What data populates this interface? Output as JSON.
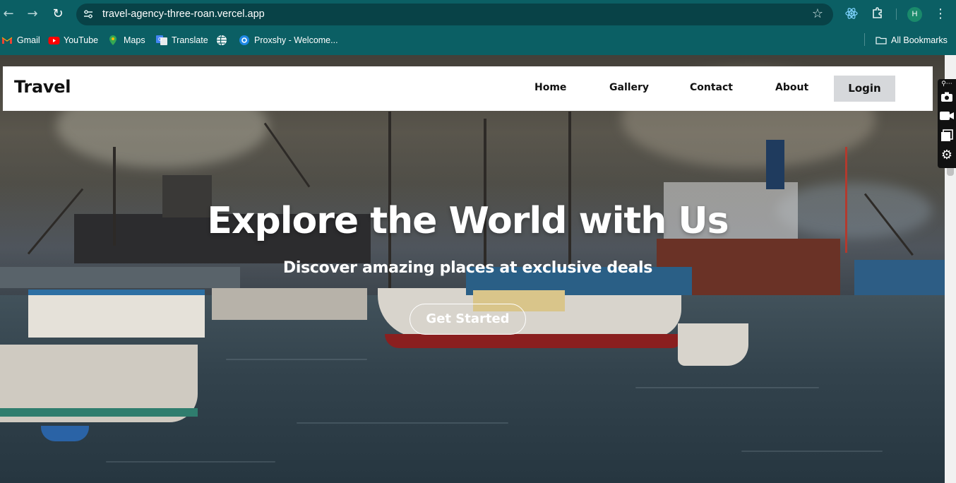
{
  "browser": {
    "url": "travel-agency-three-roan.vercel.app",
    "profile_initial": "H",
    "bookmarks": [
      {
        "label": "Gmail",
        "icon": "gmail-icon"
      },
      {
        "label": "YouTube",
        "icon": "youtube-icon"
      },
      {
        "label": "Maps",
        "icon": "maps-icon"
      },
      {
        "label": "Translate",
        "icon": "translate-icon"
      },
      {
        "label": "",
        "icon": "globe-icon"
      },
      {
        "label": "Proxshy - Welcome...",
        "icon": "proxshy-icon"
      }
    ],
    "all_bookmarks_label": "All Bookmarks"
  },
  "site": {
    "brand": "Travel",
    "nav": {
      "home": "Home",
      "gallery": "Gallery",
      "contact": "Contact",
      "about": "About",
      "login": "Login"
    },
    "hero": {
      "title": "Explore the World with Us",
      "subtitle": "Discover amazing places at exclusive deals",
      "cta": "Get Started"
    }
  },
  "colors": {
    "chrome": "#0b5f64",
    "omnibox": "#084247",
    "login_bg": "#d6d8db"
  }
}
